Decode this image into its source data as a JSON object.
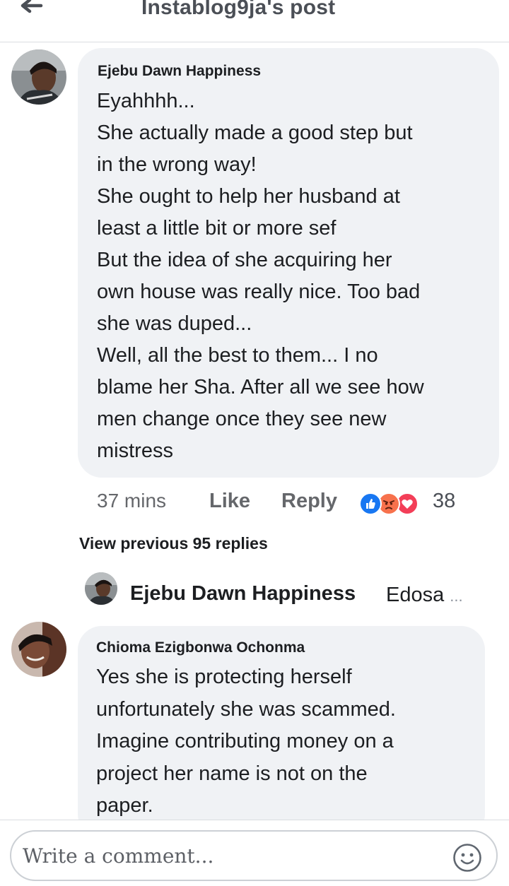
{
  "header": {
    "title": "Instablog9ja's post",
    "back_icon": "arrow-left-icon"
  },
  "comment1": {
    "author": "Ejebu Dawn Happiness",
    "lines": [
      "Eyahhhh...",
      "She actually made a good step but",
      "in the wrong way!",
      "She ought to help her husband at",
      "least a little bit or more sef",
      "But the idea of she acquiring her",
      "own house was really nice. Too bad",
      "she was duped...",
      "Well, all the best to them... I no",
      "blame her Sha. After all we see how",
      "men change once they see new",
      "mistress"
    ],
    "meta": {
      "time": "37 mins",
      "like_label": "Like",
      "reply_label": "Reply",
      "reaction_icons": [
        "like-reaction-icon",
        "angry-reaction-icon",
        "love-reaction-icon"
      ],
      "reaction_count": "38"
    }
  },
  "view_previous_label": "View previous 95 replies",
  "reply_preview": {
    "author": "Ejebu Dawn Happiness",
    "snippet": "Edosa",
    "ellipsis": "..."
  },
  "comment2": {
    "author": "Chioma Ezigbonwa Ochonma",
    "lines": [
      "Yes she is protecting herself",
      "unfortunately she was scammed.",
      "Imagine contributing money on a",
      "project her name is not on the",
      "paper."
    ]
  },
  "composer": {
    "placeholder": "Write a comment...",
    "emoji_icon": "emoji-smile-icon"
  },
  "colors": {
    "bubble": "#f0f2f5",
    "secondary_text": "#65676b",
    "like_blue": "#1877f2",
    "angry_orange": "#f7714c",
    "love_red": "#f33e58"
  }
}
